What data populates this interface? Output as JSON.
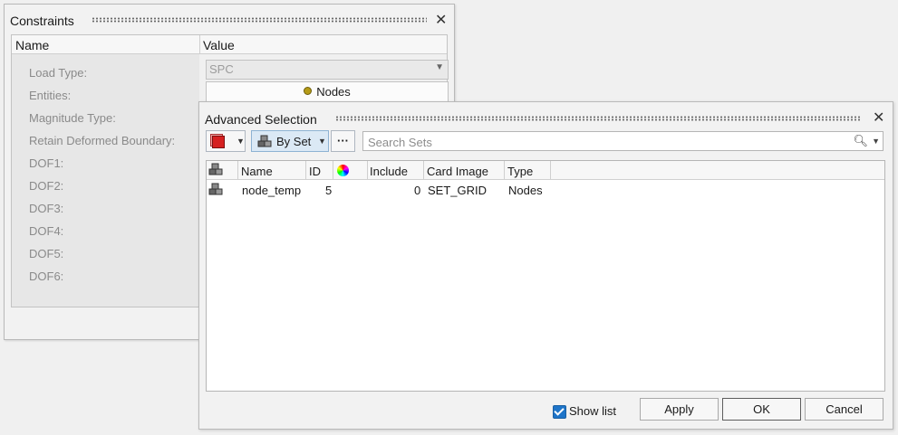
{
  "constraints": {
    "title": "Constraints",
    "header": {
      "name": "Name",
      "value": "Value"
    },
    "properties": [
      {
        "label": "Load Type:"
      },
      {
        "label": "Entities:"
      },
      {
        "label": "Magnitude Type:"
      },
      {
        "label": "Retain Deformed Boundary:"
      },
      {
        "label": "DOF1:"
      },
      {
        "label": "DOF2:"
      },
      {
        "label": "DOF3:"
      },
      {
        "label": "DOF4:"
      },
      {
        "label": "DOF5:"
      },
      {
        "label": "DOF6:"
      }
    ],
    "load_type_value": "SPC",
    "entities_value": "Nodes",
    "entities_icon": "node-dot-icon"
  },
  "advanced_selection": {
    "title": "Advanced Selection",
    "toolbar": {
      "entity_color_icon": "red-square-icon",
      "by_set_label": "By Set",
      "more_label": "···"
    },
    "search": {
      "placeholder": "Search Sets",
      "value": ""
    },
    "columns": [
      "Name",
      "ID",
      "Include",
      "Card Image",
      "Type"
    ],
    "color_column_icon": "color-wheel-icon",
    "rows": [
      {
        "name": "node_temp",
        "id": "5",
        "include": "0",
        "card_image": "SET_GRID",
        "type": "Nodes"
      }
    ],
    "show_list_label": "Show list",
    "show_list_checked": true,
    "buttons": {
      "apply": "Apply",
      "ok": "OK",
      "cancel": "Cancel"
    }
  },
  "colors": {
    "accent_blue": "#1f75c9",
    "active_toolbar": "#dbe9f5",
    "entity_red": "#d62020"
  }
}
